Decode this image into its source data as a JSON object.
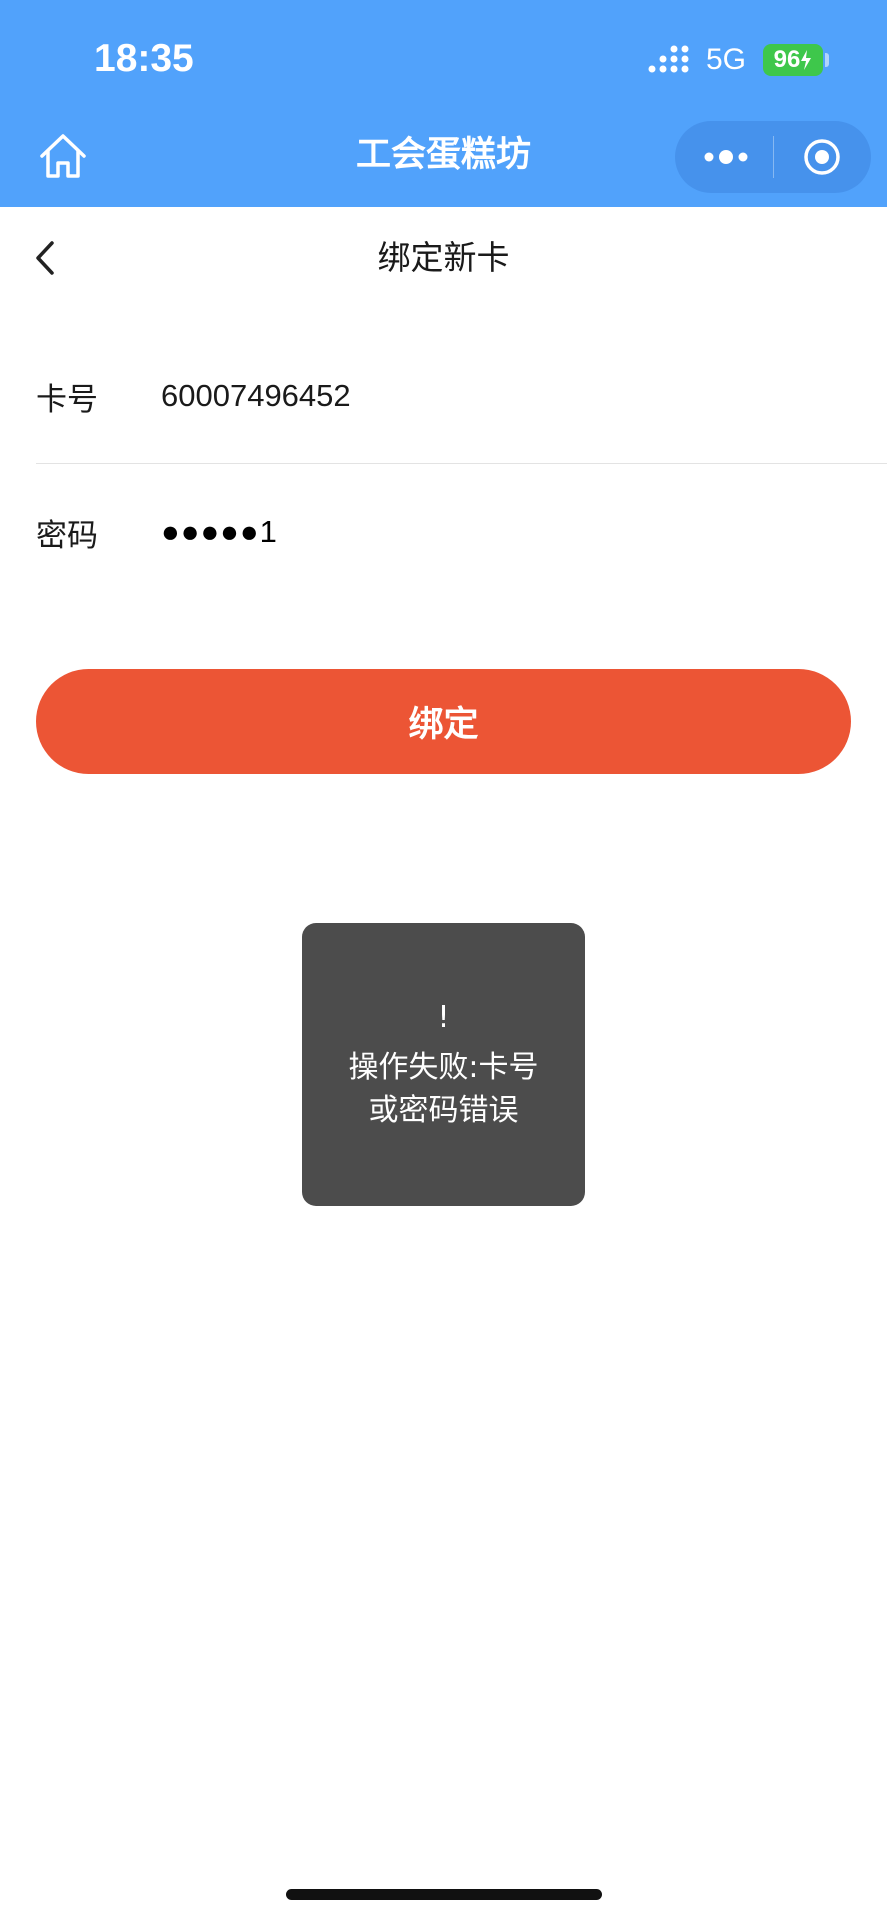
{
  "status_bar": {
    "time": "18:35",
    "network": "5G",
    "battery": "96",
    "icons": [
      "signal-icon",
      "battery-charging-icon"
    ]
  },
  "app_bar": {
    "title": "工会蛋糕坊",
    "icons": [
      "home-icon",
      "more-icon",
      "close-target-icon"
    ]
  },
  "page": {
    "title": "绑定新卡",
    "back_icon": "chevron-left-icon"
  },
  "form": {
    "card_label": "卡号",
    "card_value": "60007496452",
    "password_label": "密码",
    "password_value": "●●●●●1"
  },
  "actions": {
    "bind_label": "绑定"
  },
  "toast": {
    "icon": "!",
    "message": "操作失败:卡号或密码错误"
  },
  "colors": {
    "header_bg": "#51a2fb",
    "primary_button": "#ec5535",
    "toast_bg": "#4c4c4c",
    "battery": "#3ec74b"
  }
}
